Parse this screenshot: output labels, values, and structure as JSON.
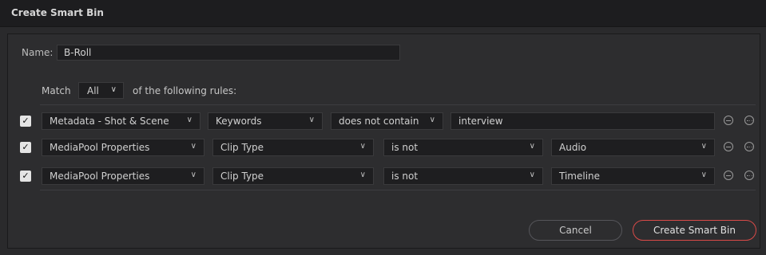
{
  "dialog": {
    "title": "Create Smart Bin"
  },
  "name": {
    "label": "Name:",
    "value": "B-Roll"
  },
  "match": {
    "label": "Match",
    "value": "All",
    "suffix": "of the following rules:"
  },
  "rules": [
    {
      "checked": true,
      "field": "Metadata - Shot & Scene",
      "property": "Keywords",
      "operator": "does not contain",
      "value": "interview",
      "value_type": "text"
    },
    {
      "checked": true,
      "field": "MediaPool Properties",
      "property": "Clip Type",
      "operator": "is not",
      "value": "Audio",
      "value_type": "select"
    },
    {
      "checked": true,
      "field": "MediaPool Properties",
      "property": "Clip Type",
      "operator": "is not",
      "value": "Timeline",
      "value_type": "select"
    }
  ],
  "buttons": {
    "cancel": "Cancel",
    "create": "Create Smart Bin"
  },
  "icons": {
    "checkbox": "check-icon",
    "remove": "minus-circle-icon",
    "more": "more-options-icon",
    "dropdown": "chevron-down-icon"
  },
  "colors": {
    "accent": "#d94a48",
    "background": "#2a2a2c",
    "titlebar": "#1d1d1f"
  }
}
